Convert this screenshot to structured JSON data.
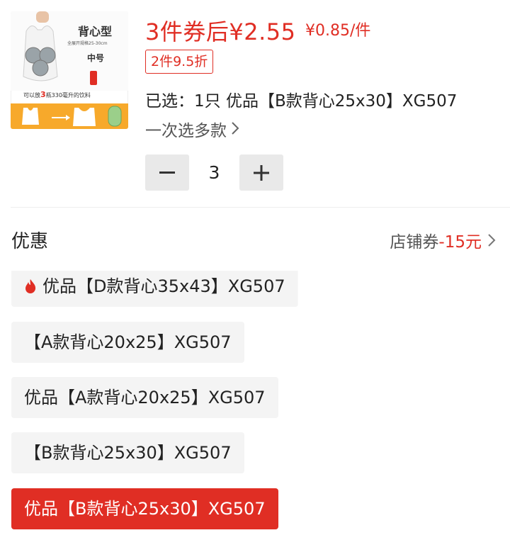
{
  "product": {
    "image": {
      "title": "背心型",
      "subtitle": "全展开规格25-30cm",
      "size": "中号",
      "note_prefix": "可以放",
      "note_number": "3",
      "note_suffix": "瓶330毫升的饮料",
      "colors": {
        "band": "#f7a92b"
      }
    },
    "price_main": "3件券后¥2.55",
    "price_unit": "¥0.85/件",
    "discount_tag": "2件9.5折",
    "selected_text": "已选：1只 优品【B款背心25x30】XG507",
    "multi_select_label": "一次选多款"
  },
  "quantity": {
    "minus_label": "−",
    "value": "3",
    "plus_label": "+"
  },
  "promotion": {
    "label": "优惠",
    "value_prefix": "店铺券",
    "value_amount": "-15元"
  },
  "options": [
    {
      "label": "优品【D款背心35x43】XG507",
      "icon": "fire-icon",
      "hot": true,
      "selected": false
    },
    {
      "label": "【A款背心20x25】XG507",
      "selected": false
    },
    {
      "label": "优品【A款背心20x25】XG507",
      "selected": false
    },
    {
      "label": "【B款背心25x30】XG507",
      "selected": false
    },
    {
      "label": "优品【B款背心25x30】XG507",
      "selected": true
    }
  ],
  "colors": {
    "accent": "#e02e24",
    "option_bg": "#f4f4f4",
    "stepper_bg": "#e9e9e9"
  }
}
